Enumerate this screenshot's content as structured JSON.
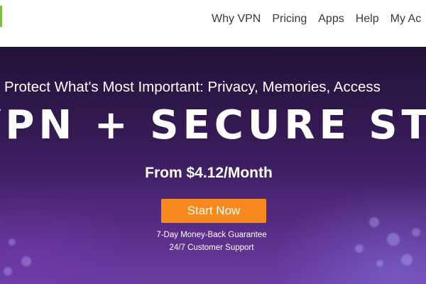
{
  "nav": {
    "items": [
      "Why VPN",
      "Pricing",
      "Apps",
      "Help",
      "My Ac"
    ]
  },
  "hero": {
    "tagline": "Protect What's Most Important: Privacy, Memories, Access",
    "headline": "VPN + SECURE STORAGE",
    "price": "From $4.12/Month",
    "cta_label": "Start Now",
    "guarantee": "7-Day Money-Back Guarantee",
    "support": "24/7 Customer Support"
  },
  "colors": {
    "brand_green": "#7bc043",
    "cta_orange": "#f7891e",
    "hero_purple": "#3a1c5c"
  }
}
